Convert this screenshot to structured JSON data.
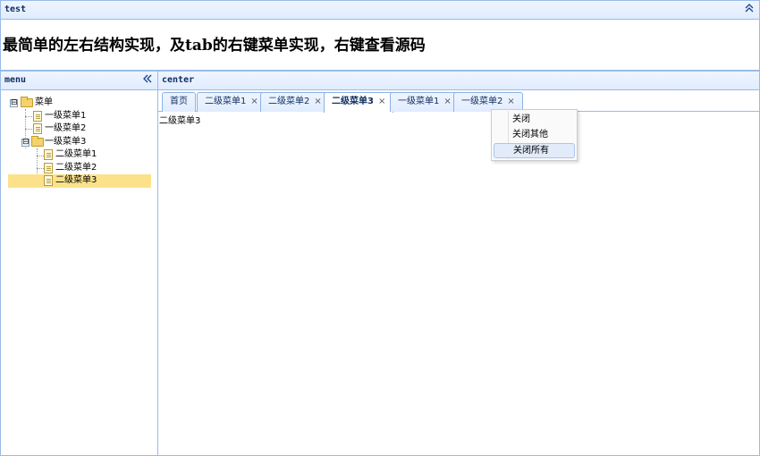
{
  "north": {
    "title": "test",
    "collapse_icon": "double-chevron-up",
    "headline": "最简单的左右结构实现，及tab的右键菜单实现，右键查看源码"
  },
  "west": {
    "title": "menu",
    "collapse_icon": "double-chevron-left",
    "tree": {
      "root": "菜单",
      "nodes": [
        {
          "label": "一级菜单1"
        },
        {
          "label": "一级菜单2"
        },
        {
          "label": "一级菜单3"
        },
        {
          "label": "二级菜单1"
        },
        {
          "label": "二级菜单2"
        },
        {
          "label": "二级菜单3",
          "selected": true
        }
      ],
      "expander_symbol": "⊟"
    }
  },
  "center": {
    "title": "center",
    "tabs": [
      {
        "label": "首页",
        "closable": false
      },
      {
        "label": "二级菜单1",
        "closable": true
      },
      {
        "label": "二级菜单2",
        "closable": true
      },
      {
        "label": "二级菜单3",
        "closable": true,
        "active": true
      },
      {
        "label": "一级菜单1",
        "closable": true
      },
      {
        "label": "一级菜单2",
        "closable": true
      }
    ],
    "close_symbol": "×",
    "content_text": "二级菜单3"
  },
  "context_menu": {
    "items": [
      {
        "label": "关闭"
      },
      {
        "label": "关闭其他"
      },
      {
        "label": "关闭所有",
        "hover": true
      }
    ]
  },
  "colors": {
    "border": "#99bbe8",
    "header_bg": "#e0ecff",
    "selected_bg": "#fbe28a"
  }
}
